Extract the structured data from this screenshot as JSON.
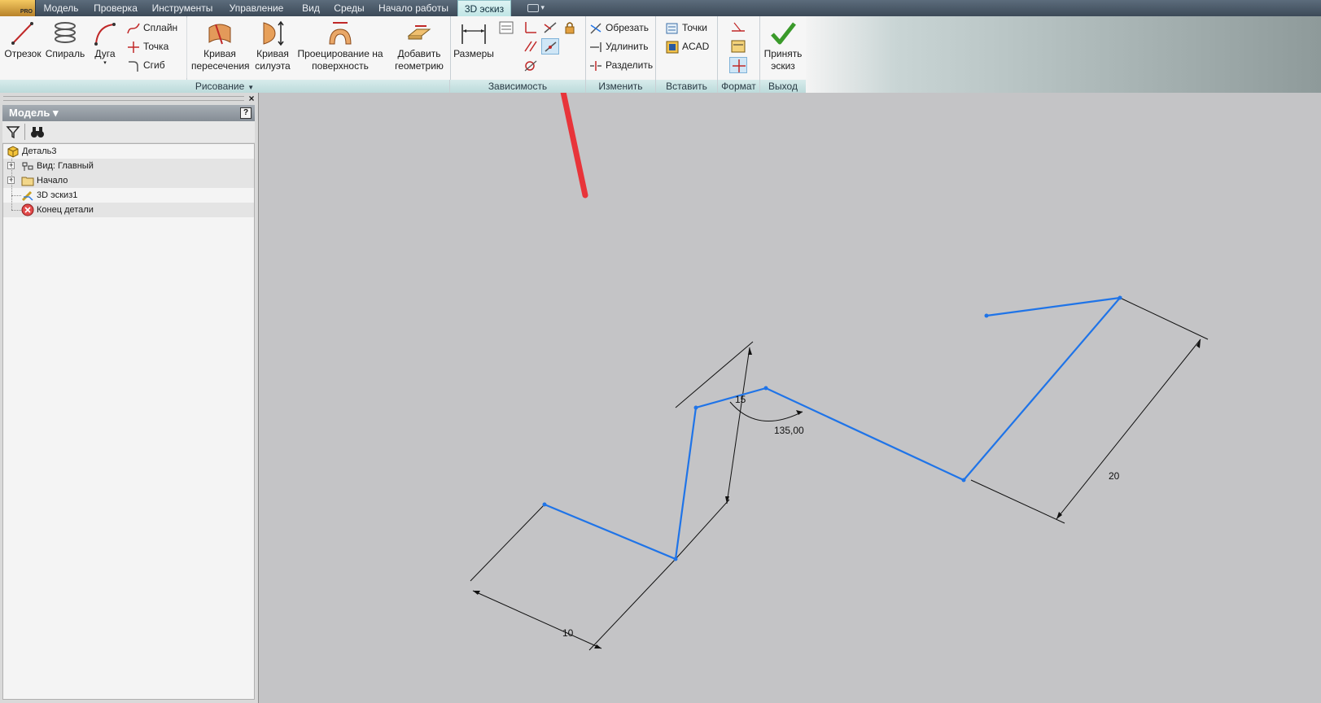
{
  "tabs": [
    {
      "label": "Модель",
      "active": false
    },
    {
      "label": "Проверка",
      "active": false
    },
    {
      "label": "Инструменты",
      "active": false
    },
    {
      "label": "Управление",
      "active": false
    },
    {
      "label": "Вид",
      "active": false
    },
    {
      "label": "Среды",
      "active": false
    },
    {
      "label": "Начало работы",
      "active": false
    },
    {
      "label": "3D эскиз",
      "active": true
    }
  ],
  "app_button_badge": "PRO",
  "ribbon": {
    "draw": {
      "title": "Рисование",
      "line": "Отрезок",
      "spiral": "Спираль",
      "arc": "Дуга",
      "spline": "Сплайн",
      "point": "Точка",
      "bend": "Сгиб",
      "intersection_curve_1": "Кривая",
      "intersection_curve_2": "пересечения",
      "silhouette_curve_1": "Кривая",
      "silhouette_curve_2": "силуэта",
      "project_1": "Проецирование на",
      "project_2": "поверхность",
      "add_geometry_1": "Добавить",
      "add_geometry_2": "геометрию"
    },
    "constraint": {
      "title": "Зависимость",
      "dimensions": "Размеры"
    },
    "modify": {
      "title": "Изменить",
      "trim": "Обрезать",
      "extend": "Удлинить",
      "split": "Разделить"
    },
    "insert": {
      "title": "Вставить",
      "points": "Точки",
      "acad": "ACAD"
    },
    "format": {
      "title": "Формат"
    },
    "exit": {
      "title": "Выход",
      "accept_1": "Принять",
      "accept_2": "эскиз"
    }
  },
  "browser": {
    "title": "Модель",
    "close_glyph": "×",
    "help_glyph": "?",
    "tree": [
      {
        "label": "Деталь3",
        "icon": "part-icon"
      },
      {
        "label": "Вид: Главный",
        "icon": "view-icon"
      },
      {
        "label": "Начало",
        "icon": "folder-icon"
      },
      {
        "label": "3D эскиз1",
        "icon": "sketch3d-icon"
      },
      {
        "label": "Конец детали",
        "icon": "end-of-part-icon"
      }
    ]
  },
  "dimensions": {
    "length_1": "10",
    "length_2": "15",
    "angle": "135,00",
    "length_3": "20"
  },
  "colors": {
    "sketch_line": "#1f74e8",
    "dimension_line": "#111111",
    "annotation_arrow": "#e8343a",
    "ribbon_panel_title": "#c3dede",
    "active_tab": "#d2eeee"
  }
}
